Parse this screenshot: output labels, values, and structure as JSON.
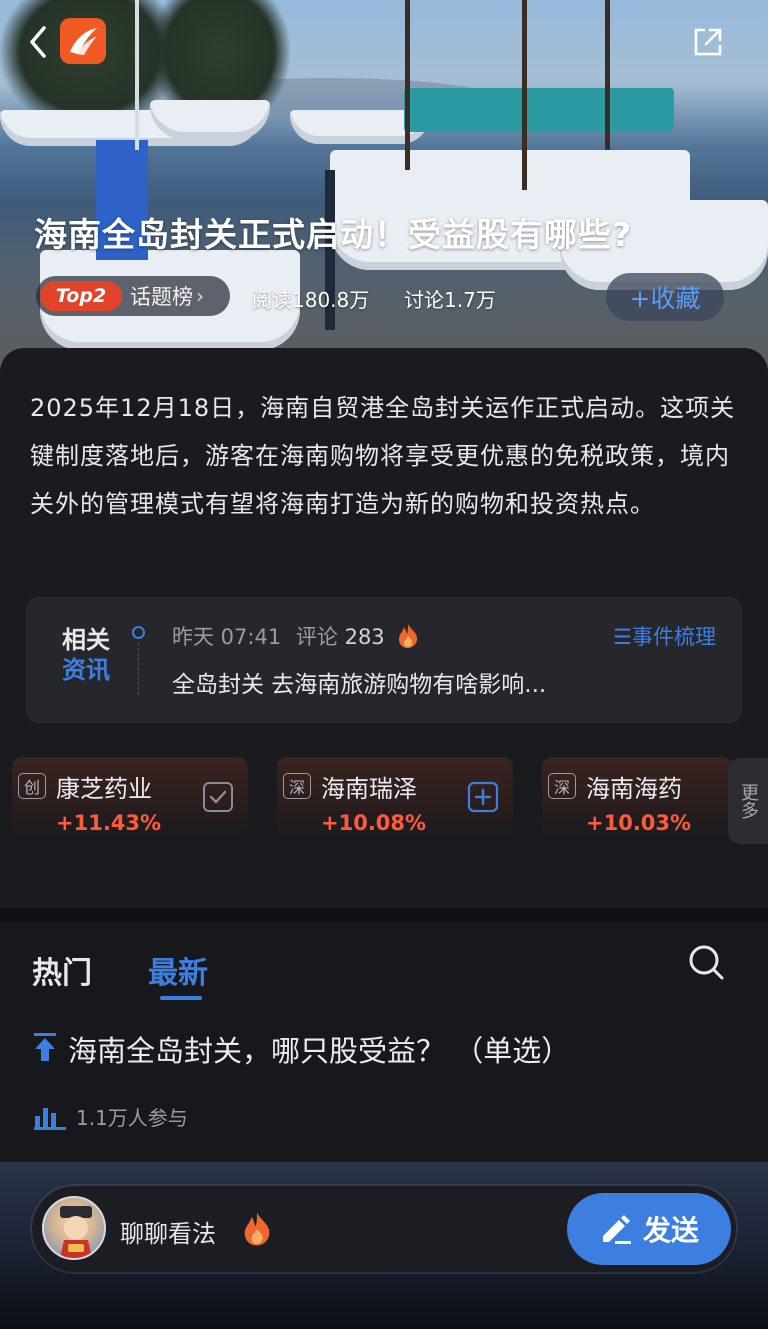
{
  "header": {
    "topic_title": "海南全岛封关正式启动！受益股有哪些?",
    "rank_badge": "Top2",
    "rank_label": "话题榜",
    "read_count": "阅读180.8万",
    "discuss_count": "讨论1.7万",
    "favorite_label": "+收藏"
  },
  "summary": "2025年12月18日，海南自贸港全岛封关运作正式启动。这项关键制度落地后，游客在海南购物将享受更优惠的免税政策，境内关外的管理模式有望将海南打造为新的购物和投资热点。",
  "news": {
    "tag_line1": "相关",
    "tag_line2": "资讯",
    "time": "昨天 07:41",
    "comment_label": "评论",
    "comment_count": "283",
    "timeline_link": "☰事件梳理",
    "headline": "全岛封关 去海南旅游购物有啥影响..."
  },
  "stocks": [
    {
      "market": "创",
      "name": "康芝药业",
      "change": "+11.43%",
      "action": "check-icon"
    },
    {
      "market": "深",
      "name": "海南瑞泽",
      "change": "+10.08%",
      "action": "plus-icon"
    },
    {
      "market": "深",
      "name": "海南海药",
      "change": "+10.03%",
      "action": ""
    }
  ],
  "more_label": "更多",
  "tabs": [
    {
      "label": "热门",
      "active": false
    },
    {
      "label": "最新",
      "active": true
    }
  ],
  "poll": {
    "question": "海南全岛封关，哪只股受益？ （单选）",
    "participants": "1.1万人参与"
  },
  "composer": {
    "placeholder": "聊聊看法",
    "send_label": "发送"
  },
  "colors": {
    "accent": "#3c7fe0",
    "up": "#ff5a3c",
    "badge": "#e2442b",
    "logo": "#f15a24"
  }
}
